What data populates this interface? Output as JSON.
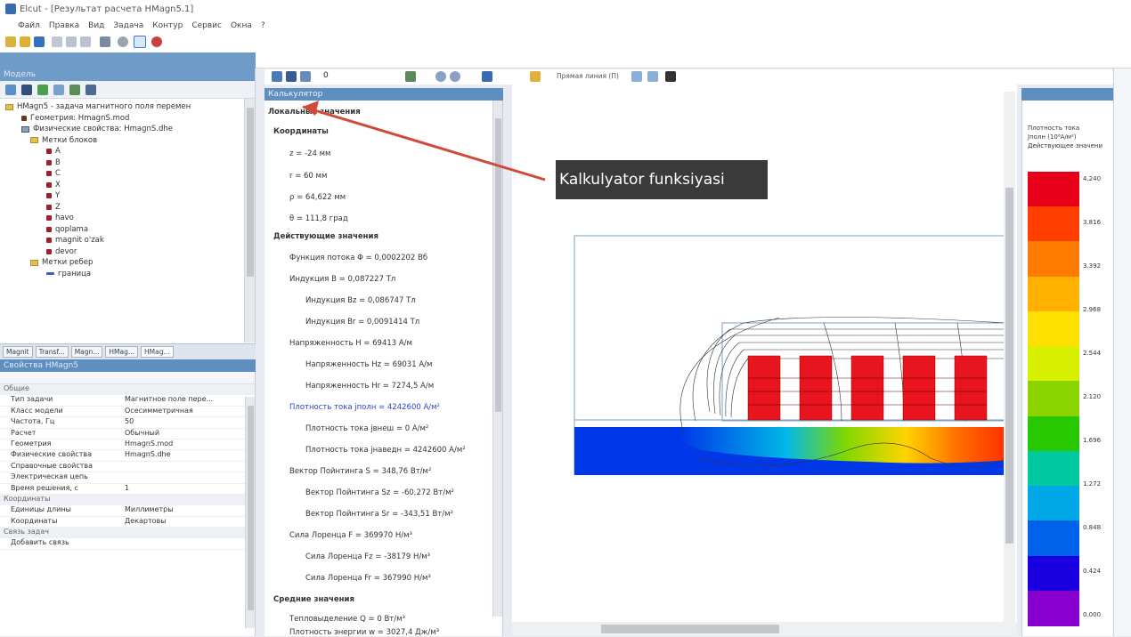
{
  "window": {
    "title": "Elcut - [Результат расчета HMagn5.1]"
  },
  "menu": [
    "Файл",
    "Правка",
    "Вид",
    "Задача",
    "Контур",
    "Сервис",
    "Окна",
    "?"
  ],
  "left_panel": {
    "header": "Модель",
    "tree": [
      {
        "label": "HMagn5 - задача магнитного поля перемен",
        "level": 0,
        "kind": "folder"
      },
      {
        "label": "Геометрия: HmagnS.mod",
        "level": 1,
        "kind": "geo"
      },
      {
        "label": "Физические свойства: HmagnS.dhe",
        "level": 1,
        "kind": "folder"
      },
      {
        "label": "Метки блоков",
        "level": 2,
        "kind": "folder"
      },
      {
        "label": "A",
        "level": 3,
        "kind": "item"
      },
      {
        "label": "B",
        "level": 3,
        "kind": "item"
      },
      {
        "label": "C",
        "level": 3,
        "kind": "item"
      },
      {
        "label": "X",
        "level": 3,
        "kind": "item"
      },
      {
        "label": "Y",
        "level": 3,
        "kind": "item"
      },
      {
        "label": "Z",
        "level": 3,
        "kind": "item"
      },
      {
        "label": "havo",
        "level": 3,
        "kind": "item"
      },
      {
        "label": "qoplama",
        "level": 3,
        "kind": "item"
      },
      {
        "label": "magnit o'zak",
        "level": 3,
        "kind": "item"
      },
      {
        "label": "devor",
        "level": 3,
        "kind": "item"
      },
      {
        "label": "Метки ребер",
        "level": 2,
        "kind": "folder"
      },
      {
        "label": "граница",
        "level": 3,
        "kind": "edge"
      }
    ],
    "tabs": [
      "Magnit",
      "Transf...",
      "Magn...",
      "HMag...",
      "HMag..."
    ]
  },
  "properties": {
    "header": "Свойства HMagn5",
    "rows": [
      {
        "k": "Общие",
        "v": "",
        "cat": true
      },
      {
        "k": "Тип задачи",
        "v": "Магнитное поле пере..."
      },
      {
        "k": "Класс модели",
        "v": "Осесимметричная"
      },
      {
        "k": "Частота, Гц",
        "v": "50"
      },
      {
        "k": "Расчет",
        "v": "Обычный"
      },
      {
        "k": "Геометрия",
        "v": "HmagnS.mod"
      },
      {
        "k": "Физические свойства",
        "v": "HmagnS.dhe"
      },
      {
        "k": "Справочные свойства",
        "v": ""
      },
      {
        "k": "Электрическая цепь",
        "v": ""
      },
      {
        "k": "Время решения, с",
        "v": "1"
      },
      {
        "k": "Координаты",
        "v": "",
        "cat": true
      },
      {
        "k": "Единицы длины",
        "v": "Миллиметры"
      },
      {
        "k": "Координаты",
        "v": "Декартовы"
      },
      {
        "k": "Связь задач",
        "v": "",
        "cat": true
      },
      {
        "k": "Добавить связь",
        "v": ""
      }
    ]
  },
  "results_toolbar": {
    "field_value": "0",
    "view_label": "Прямая линия (П)"
  },
  "local": {
    "header": "Калькулятор",
    "title": "Локальные значения",
    "coords_title": "Координаты",
    "z": "z = -24 мм",
    "r": "r = 60 мм",
    "rho": "ρ = 64,622 мм",
    "theta": "θ = 111,8 град",
    "eff_title": "Действующие значения",
    "flux": "Функция потока Φ = 0,0002202 Вб",
    "B": "Индукция B = 0,087227 Тл",
    "Bz": "Индукция Bz = 0,086747 Тл",
    "Br": "Индукция Br = 0,0091414 Тл",
    "H": "Напряженность H = 69413 А/м",
    "Hz": "Напряженность Hz = 69031 А/м",
    "Hr": "Напряженность Hr = 7274,5 А/м",
    "J": "Плотность тока jполн = 4242600 А/м²",
    "Jsrc": "Плотность тока jвнеш = 0 А/м²",
    "Jind": "Плотность тока jнаведн = 4242600 А/м²",
    "S": "Вектор Пойнтинга S = 348,76 Вт/м²",
    "Sz": "Вектор Пойнтинга Sz = -60,272 Вт/м²",
    "Sr": "Вектор Пойнтинга Sr = -343,51 Вт/м²",
    "F": "Сила Лоренца F = 369970 Н/м³",
    "Fz": "Сила Лоренца Fz = -38179 Н/м³",
    "Fr": "Сила Лоренца Fr = 367990 Н/м³",
    "avg_title": "Средние значения",
    "Q": "Тепловыделение Q = 0 Вт/м³",
    "W": "Плотность энергии w = 3027,4 Дж/м³"
  },
  "callout": "Kalkulyator funksiyasi",
  "legend": {
    "title1": "Плотность тока",
    "title2": "Jполн (10⁶А/м²)",
    "title3": "Действующее значени",
    "values": [
      "4.240",
      "3.816",
      "3.392",
      "2.968",
      "2.544",
      "2.120",
      "1.696",
      "1.272",
      "0.848",
      "0.424",
      "0.000"
    ],
    "colors": [
      "#e8001a",
      "#ff3e00",
      "#ff7a00",
      "#ffb000",
      "#ffe000",
      "#d7ef00",
      "#8cd400",
      "#28c800",
      "#00c8a0",
      "#00a8e8",
      "#0062e8",
      "#1a00e0",
      "#8800d0"
    ]
  }
}
